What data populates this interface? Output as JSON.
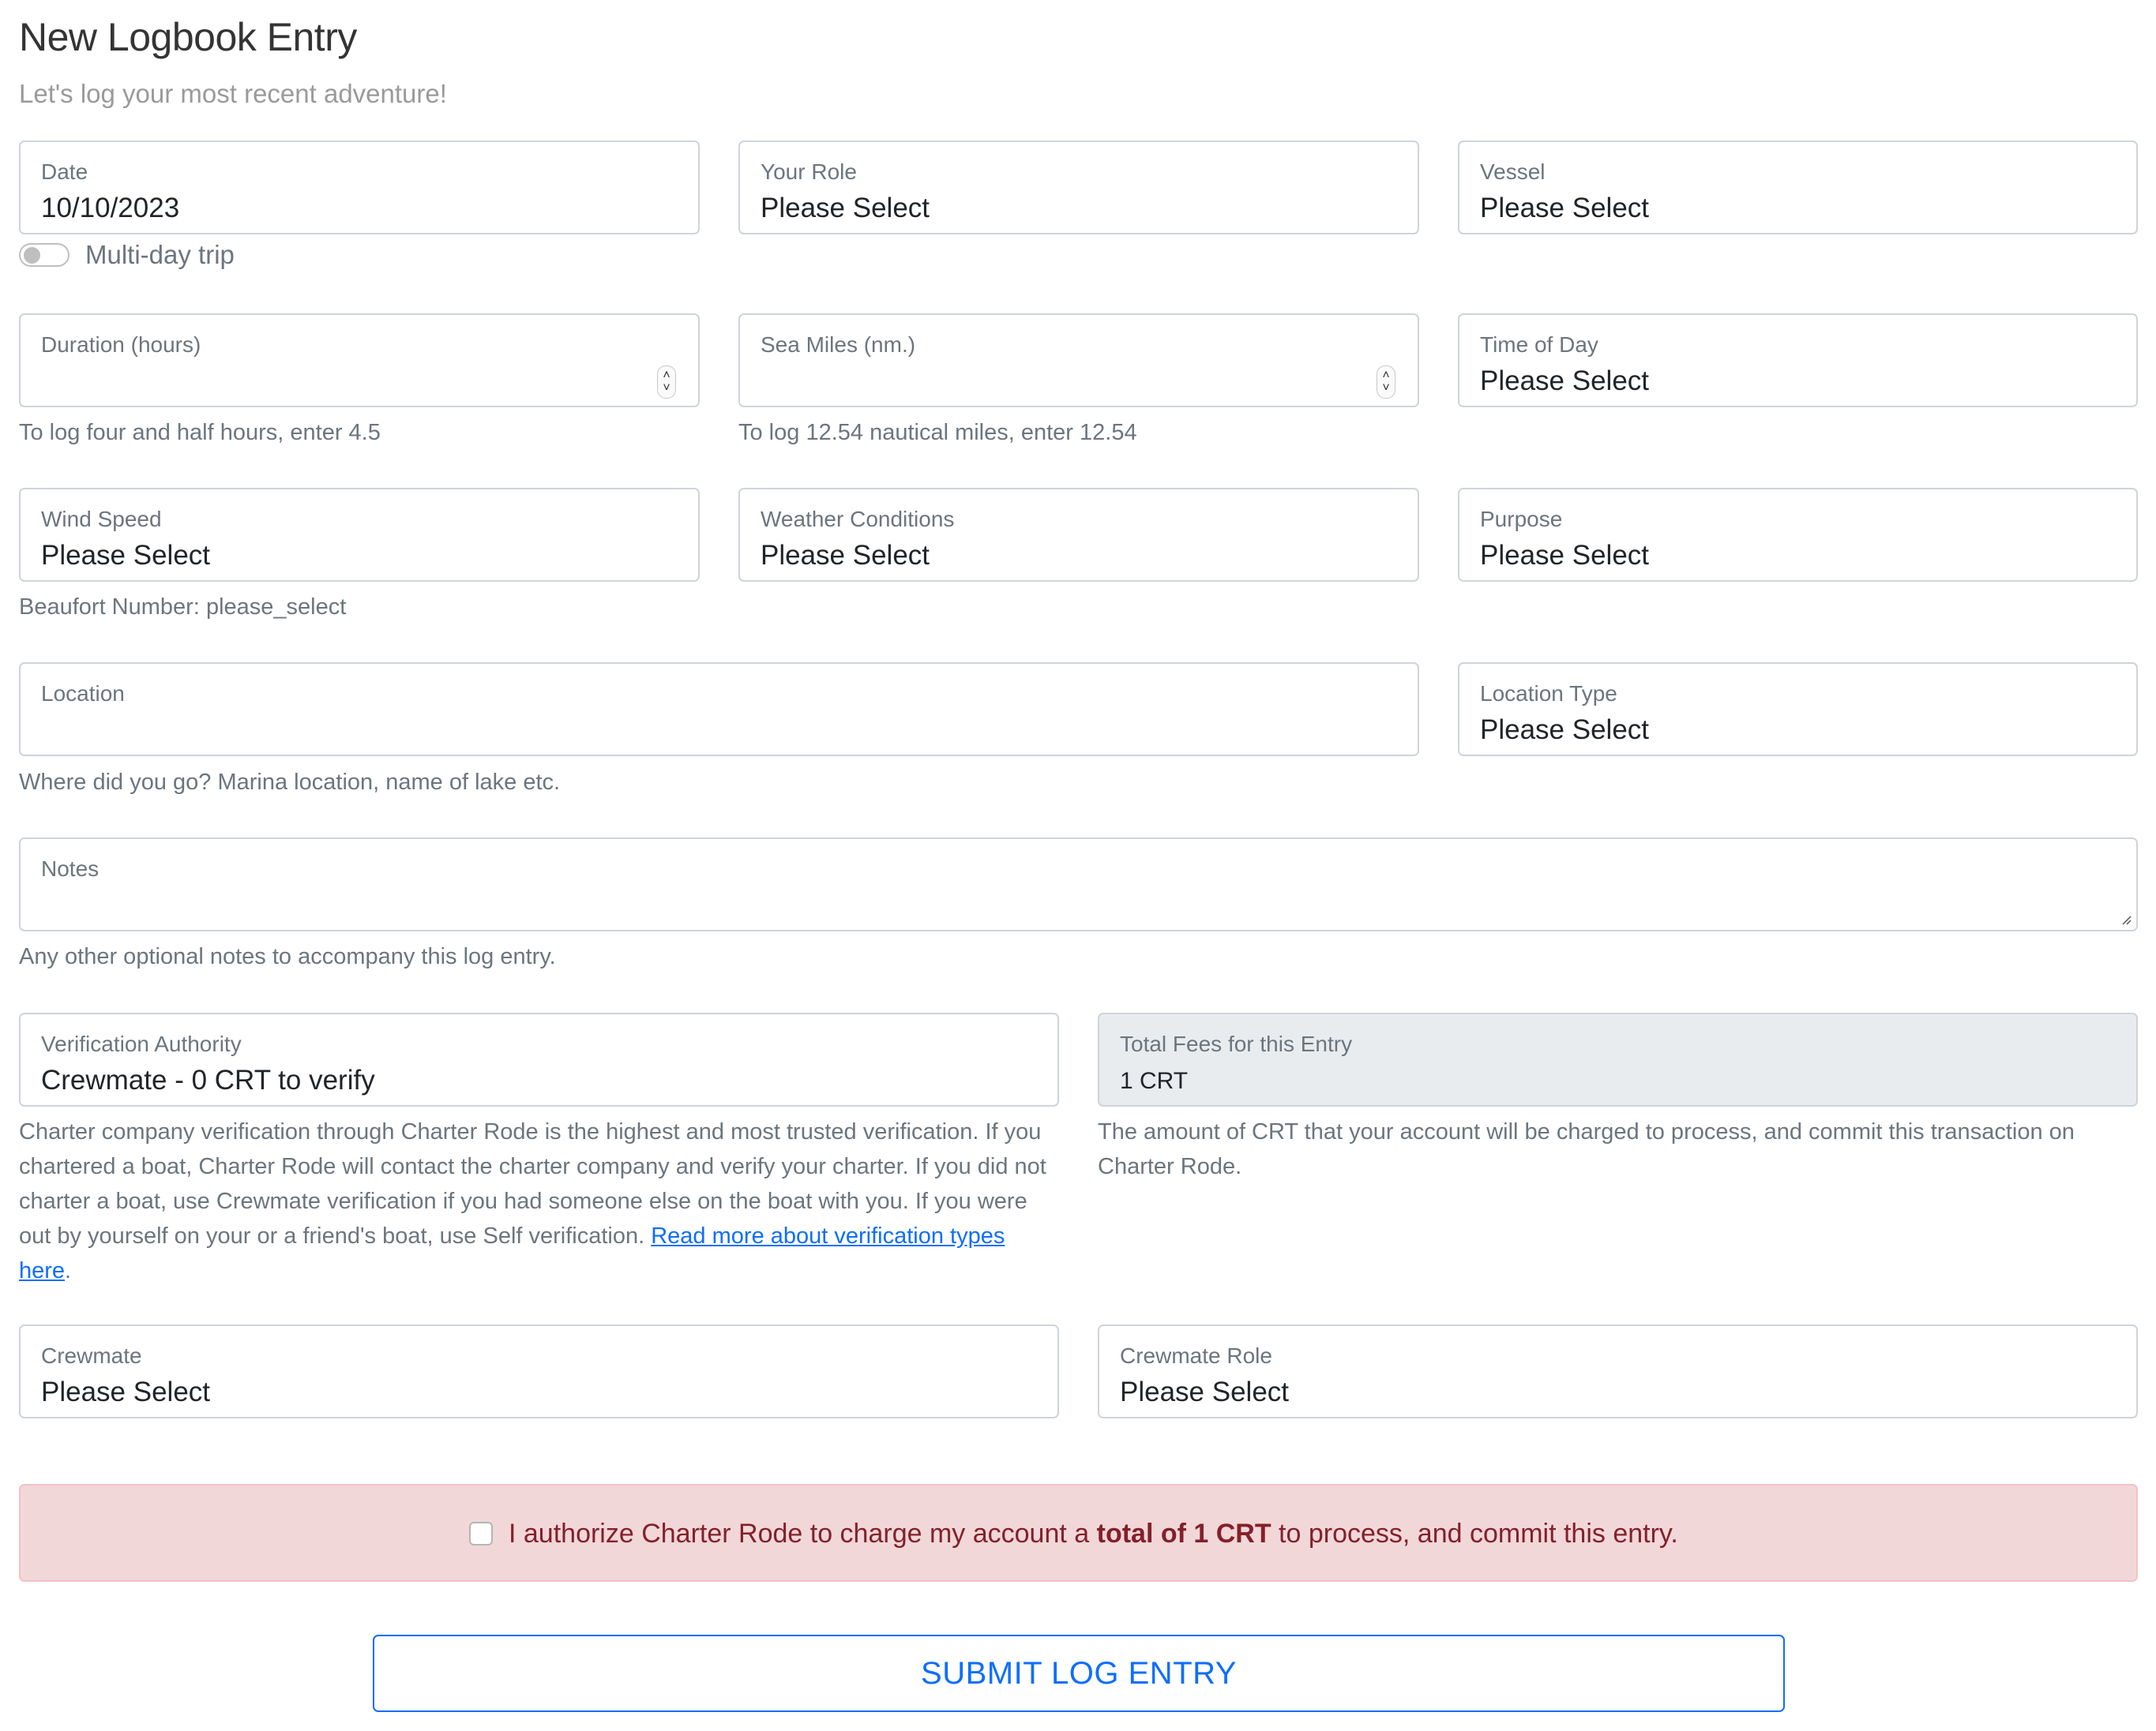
{
  "header": {
    "title": "New Logbook Entry",
    "subtitle": "Let's log your most recent adventure!"
  },
  "fields": {
    "date": {
      "label": "Date",
      "value": "10/10/2023"
    },
    "multi_day": {
      "label": "Multi-day trip",
      "checked": false
    },
    "role": {
      "label": "Your Role",
      "value": "Please Select"
    },
    "vessel": {
      "label": "Vessel",
      "value": "Please Select"
    },
    "duration": {
      "label": "Duration (hours)",
      "value": "",
      "help": "To log four and half hours, enter 4.5"
    },
    "sea_miles": {
      "label": "Sea Miles (nm.)",
      "value": "",
      "help": "To log 12.54 nautical miles, enter 12.54"
    },
    "time_of_day": {
      "label": "Time of Day",
      "value": "Please Select"
    },
    "wind_speed": {
      "label": "Wind Speed",
      "value": "Please Select",
      "help": "Beaufort Number: please_select"
    },
    "weather": {
      "label": "Weather Conditions",
      "value": "Please Select"
    },
    "purpose": {
      "label": "Purpose",
      "value": "Please Select"
    },
    "location": {
      "label": "Location",
      "value": "",
      "help": "Where did you go? Marina location, name of lake etc."
    },
    "location_type": {
      "label": "Location Type",
      "value": "Please Select"
    },
    "notes": {
      "label": "Notes",
      "value": "",
      "help": "Any other optional notes to accompany this log entry."
    },
    "verification": {
      "label": "Verification Authority",
      "value": "Crewmate - 0 CRT to verify",
      "help": "Charter company verification through Charter Rode is the highest and most trusted verification. If you chartered a boat, Charter Rode will contact the charter company and verify your charter. If you did not charter a boat, use Crewmate verification if you had someone else on the boat with you. If you were out by yourself on your or a friend's boat, use Self verification. ",
      "link_text": "Read more about verification types here",
      "help_tail": "."
    },
    "total_fees": {
      "label": "Total Fees for this Entry",
      "value": "1 CRT",
      "help": "The amount of CRT that your account will be charged to process, and commit this transaction on Charter Rode."
    },
    "crewmate": {
      "label": "Crewmate",
      "value": "Please Select"
    },
    "crewmate_role": {
      "label": "Crewmate Role",
      "value": "Please Select"
    }
  },
  "authorization": {
    "checked": false,
    "text_before": "I authorize Charter Rode to charge my account a ",
    "text_bold": "total of 1 CRT",
    "text_after": " to process, and commit this entry."
  },
  "submit": {
    "label": "SUBMIT LOG ENTRY"
  },
  "colors": {
    "accent": "#0d6efd",
    "alert_bg": "#f2d7d9",
    "alert_text": "#842029",
    "disabled_bg": "#e9ecef"
  }
}
